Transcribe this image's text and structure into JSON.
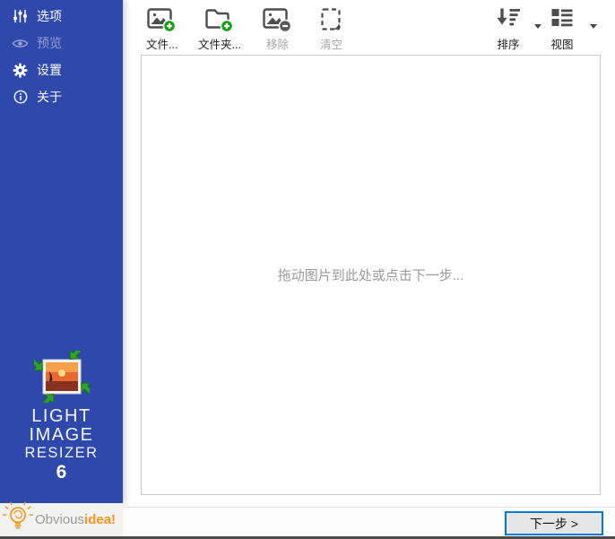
{
  "sidebar": {
    "items": [
      {
        "id": "options",
        "label": "选项",
        "icon": "sliders-icon",
        "enabled": true
      },
      {
        "id": "preview",
        "label": "预览",
        "icon": "eye-icon",
        "enabled": false
      },
      {
        "id": "settings",
        "label": "设置",
        "icon": "gear-icon",
        "enabled": true
      },
      {
        "id": "about",
        "label": "关于",
        "icon": "info-icon",
        "enabled": true
      }
    ],
    "logo": {
      "line1": "LIGHT",
      "line2": "IMAGE",
      "line3": "RESIZER",
      "version": "6"
    },
    "brand": {
      "name_part1": "Obvious",
      "name_part2": "idea!"
    }
  },
  "toolbar": {
    "buttons": [
      {
        "id": "add-files",
        "label": "文件...",
        "icon": "add-image-icon",
        "enabled": true,
        "has_dropdown": false
      },
      {
        "id": "add-folder",
        "label": "文件夹...",
        "icon": "add-folder-icon",
        "enabled": true,
        "has_dropdown": false
      },
      {
        "id": "remove",
        "label": "移除",
        "icon": "remove-image-icon",
        "enabled": false,
        "has_dropdown": false
      },
      {
        "id": "clear",
        "label": "清空",
        "icon": "clear-icon",
        "enabled": false,
        "has_dropdown": false
      },
      {
        "id": "sort",
        "label": "排序",
        "icon": "sort-icon",
        "enabled": true,
        "has_dropdown": true
      },
      {
        "id": "view",
        "label": "视图",
        "icon": "view-icon",
        "enabled": true,
        "has_dropdown": true
      }
    ]
  },
  "main": {
    "dropzone_hint": "拖动图片到此处或点击下一步..."
  },
  "footer": {
    "next_button_label": "下一步 >"
  },
  "colors": {
    "sidebar_blue": "#2e48ac",
    "accent_green": "#12a212",
    "focus_border_blue": "#0078d7",
    "brand_orange": "#f7941d",
    "disabled_text": "#a6a6a6",
    "hint_text": "#9a9a9a"
  }
}
